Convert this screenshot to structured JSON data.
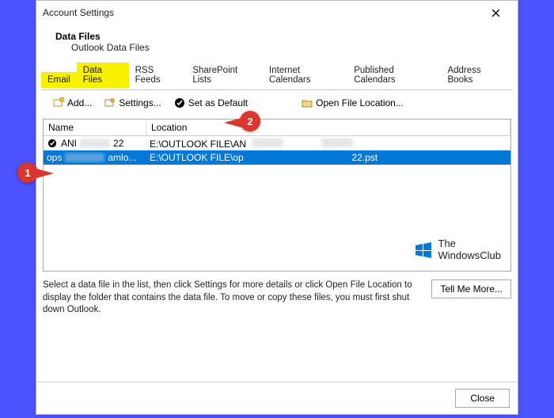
{
  "window": {
    "title": "Account Settings",
    "close_icon": "close"
  },
  "header": {
    "title": "Data Files",
    "subtitle": "Outlook Data Files"
  },
  "tabs": [
    {
      "label": "Email",
      "highlight": true
    },
    {
      "label": "Data Files",
      "highlight": true
    },
    {
      "label": "RSS Feeds"
    },
    {
      "label": "SharePoint Lists"
    },
    {
      "label": "Internet Calendars"
    },
    {
      "label": "Published Calendars"
    },
    {
      "label": "Address Books"
    }
  ],
  "toolbar": {
    "add": "Add...",
    "settings": "Settings...",
    "set_default": "Set as Default",
    "remove": "",
    "open_location": "Open File Location..."
  },
  "table": {
    "headers": {
      "name": "Name",
      "location": "Location"
    },
    "rows": [
      {
        "name_prefix": "ANI",
        "name_suffix": "22",
        "location_prefix": "E:\\OUTLOOK FILE\\AN",
        "selected": false,
        "default": true
      },
      {
        "name_prefix": "ops",
        "name_suffix": "amlo...",
        "location_prefix": "E:\\OUTLOOK FILE\\op",
        "location_suffix": "22.pst",
        "selected": true,
        "default": false
      }
    ]
  },
  "hint": "Select a data file in the list, then click Settings for more details or click Open File Location to display the folder that contains the data file. To move or copy these files, you must first shut down Outlook.",
  "tell_me_more": "Tell Me More...",
  "close_button": "Close",
  "branding": {
    "line1": "The",
    "line2": "WindowsClub"
  },
  "annotations": {
    "one": "1",
    "two": "2"
  }
}
